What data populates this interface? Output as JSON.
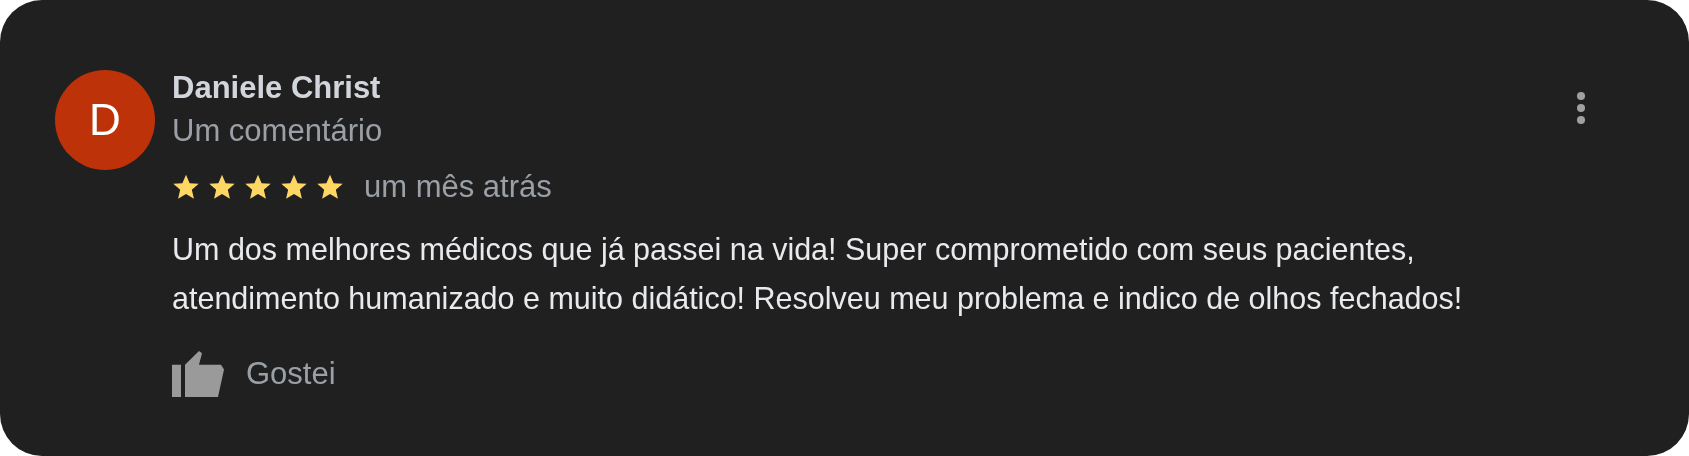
{
  "review": {
    "avatar_letter": "D",
    "author": "Daniele Christ",
    "subtitle": "Um comentário",
    "stars": 5,
    "time": "um mês atrás",
    "text": "Um dos melhores médicos que já passei na vida! Super comprometido com seus pacientes, atendimento humanizado e muito didático! Resolveu meu problema e indico de olhos fechados!",
    "like_label": "Gostei"
  }
}
